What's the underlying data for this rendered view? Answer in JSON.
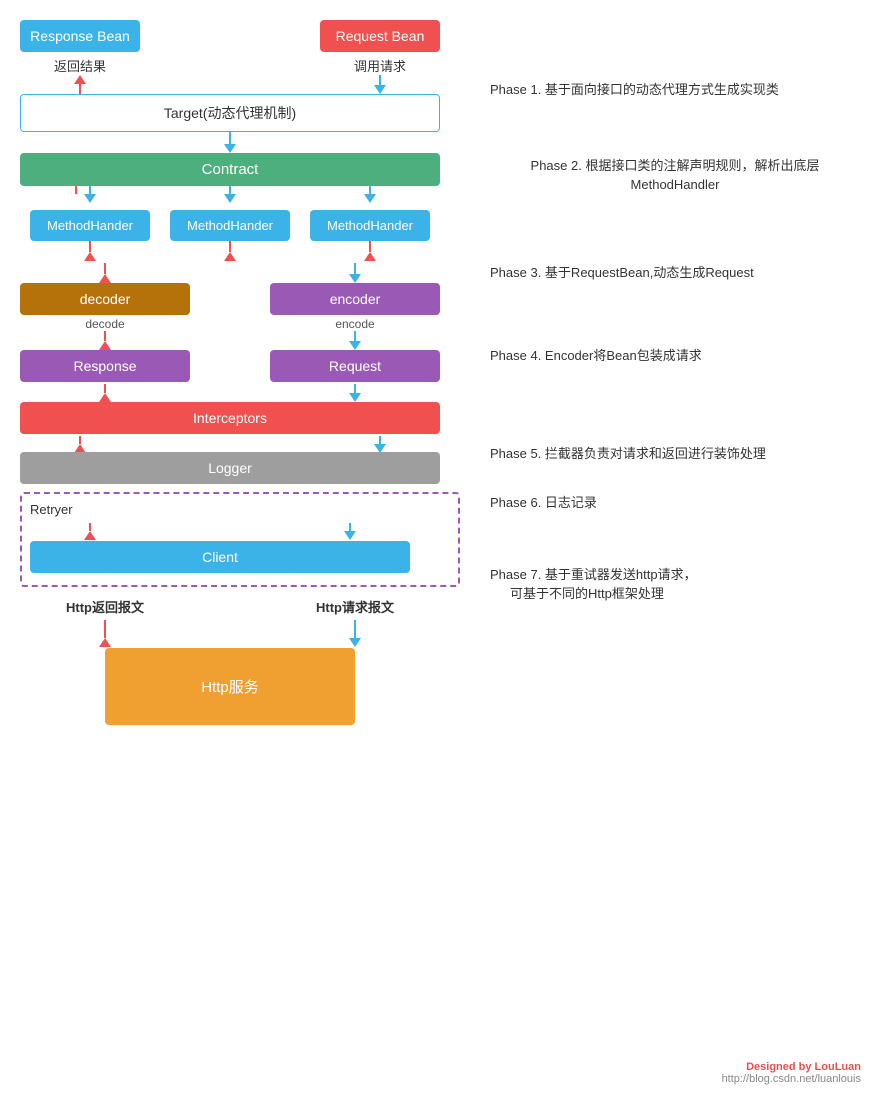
{
  "beans": {
    "response_bean": "Response Bean",
    "request_bean": "Request Bean",
    "return_label": "返回结果",
    "call_label": "调用请求"
  },
  "boxes": {
    "target": "Target(动态代理机制)",
    "contract": "Contract",
    "method1": "MethodHander",
    "method2": "MethodHander",
    "method3": "MethodHander",
    "decoder": "decoder",
    "encoder": "encoder",
    "response": "Response",
    "request": "Request",
    "interceptors": "Interceptors",
    "logger": "Logger",
    "retryer_label": "Retryer",
    "client": "Client",
    "http_service": "Http服务"
  },
  "arrows": {
    "decode_label": "decode",
    "encode_label": "encode",
    "http_return": "Http返回报文",
    "http_request": "Http请求报文"
  },
  "phases": {
    "phase1": "Phase 1. 基于面向接口的动态代理方式生成实现类",
    "phase2_line1": "Phase 2. 根据接口类的注解声明规则，解析出底层",
    "phase2_line2": "MethodHandler",
    "phase3": "Phase 3. 基于RequestBean,动态生成Request",
    "phase4": "Phase 4. Encoder将Bean包装成请求",
    "phase5": "Phase 5. 拦截器负责对请求和返回进行装饰处理",
    "phase6": "Phase 6. 日志记录",
    "phase7_line1": "Phase 7. 基于重试器发送http请求，",
    "phase7_line2": "可基于不同的Http框架处理"
  },
  "footer": {
    "designed": "Designed by LouLuan",
    "url": "http://blog.csdn.net/luanlouis"
  }
}
